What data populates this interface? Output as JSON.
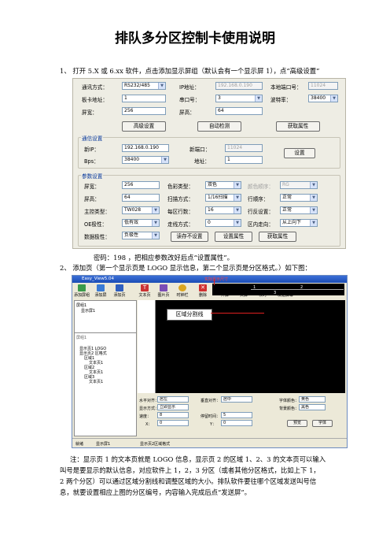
{
  "title": "排队多分区控制卡使用说明",
  "step1": "1、  打开 5.X 或 6.xx 软件，点击添加显示屏组（默认会有一个显示屏 1），点“高级设置”",
  "dialog": {
    "row1": {
      "comm_label": "通讯方式：",
      "comm_value": "RS232/485",
      "ip_label": "IP地址：",
      "ip_value": "192.168.0.190",
      "port_label": "本地端口号：",
      "port_value": "11024"
    },
    "row2": {
      "addr_label": "板卡地址：",
      "addr_value": "1",
      "serial_label": "串口号：",
      "serial_value": "3",
      "baud_label": "波特率：",
      "baud_value": "38400"
    },
    "row3": {
      "width_label": "屏宽：",
      "width_value": "256",
      "height_label": "屏高：",
      "height_value": "64"
    },
    "buttons": {
      "advanced": "高级设置",
      "auto_detect": "自动检测",
      "get_props": "获取属性"
    },
    "comm_group": {
      "title": "通信设置",
      "ip_label": "新IP：",
      "ip_value": "192.168.0.190",
      "port_label": "新端口：",
      "port_value": "11024",
      "bps_label": "Bps：",
      "bps_value": "38400",
      "addr_label": "地址：",
      "addr_value": "1",
      "set_button": "设置"
    },
    "param_group": {
      "title": "参数设置",
      "width_label": "屏宽：",
      "width_value": "256",
      "height_label": "屏高：",
      "height_value": "64",
      "ctrl_label": "主控类型：",
      "ctrl_value": "TW028",
      "oe_label": "OE极性：",
      "oe_value": "低有效",
      "data_label": "数据极性：",
      "data_value": "负极性",
      "color_label": "色彩类型：",
      "color_value": "双色",
      "scan_label": "扫描方式：",
      "scan_value": "1/16扫描",
      "rows_label": "每区行数：",
      "rows_value": "16",
      "walk_label": "走线方式：",
      "walk_value": "0",
      "order_label": "颜色顺序：",
      "order_value": "RG",
      "row_order_label": "行顺序：",
      "row_order_value": "正常",
      "row_rev_label": "行反设置：",
      "row_rev_value": "正常",
      "dir_label": "区内走向：",
      "dir_value": "从上向下",
      "btn_read": "读存不设置",
      "btn_set": "设置属性",
      "btn_get": "获取属性"
    }
  },
  "note1": "密码：198 ，把相应参数改好后点“设置属性”。",
  "step2": "2、  添加页（第一个显示页是 LOGO 显示信息，第二个显示页是分区格式。）如下图：",
  "editor": {
    "window_title": "Easy_View5.04",
    "annot_top": "实际显示尺寸",
    "annot_mid": "区域分割线",
    "toolbar": [
      "添加屏组",
      "添加屏",
      "添加页",
      "文本页",
      "图片页",
      "时钟栏",
      "删除",
      "开屏",
      "关屏",
      "校时",
      "发送屏幕"
    ],
    "tree": [
      "屏组1",
      "显示屏1",
      "显示页1 LOGO",
      "显示页2 区格式",
      "区域1",
      "文本页1",
      "区域2",
      "文本页1",
      "区域3",
      "文本页1"
    ],
    "preview_nums": [
      "1",
      "2",
      "3"
    ],
    "prop_labels": [
      "水平对齐：",
      "显示方式：",
      "速度：",
      "X：",
      "垂直对齐：",
      "停留时间：",
      "Y：",
      "字体颜色：",
      "背景颜色："
    ],
    "prop_values": [
      "居左",
      "立即显示",
      "8",
      "0",
      "居中",
      "5",
      "0",
      "黄色",
      "黑色"
    ],
    "prop_buttons": [
      "预览",
      "字体"
    ],
    "status": [
      "就绪",
      "显示屏1",
      "显示页2区域格式"
    ]
  },
  "note2_lines": [
    "注：显示页 1 的文本页就是 LOGO 信息，显示页 2 的区域 1、2、3 的文本页可以输入",
    "叫号是要显示的默认信息，对应软件上 1，2，3 分区（或者其他分区格式，比如上下 1，",
    "2 两个分区）可以通过区域分割线和调整区域的大小。排队软件要往哪个区域发送叫号信",
    "息，就要设置相应上图的分区编号，内容输入完成后点“发送屏”。"
  ],
  "colors": {
    "accent_blue": "#1b4db5",
    "arrow_red": "#e02020",
    "field_border": "#7f9db9"
  }
}
